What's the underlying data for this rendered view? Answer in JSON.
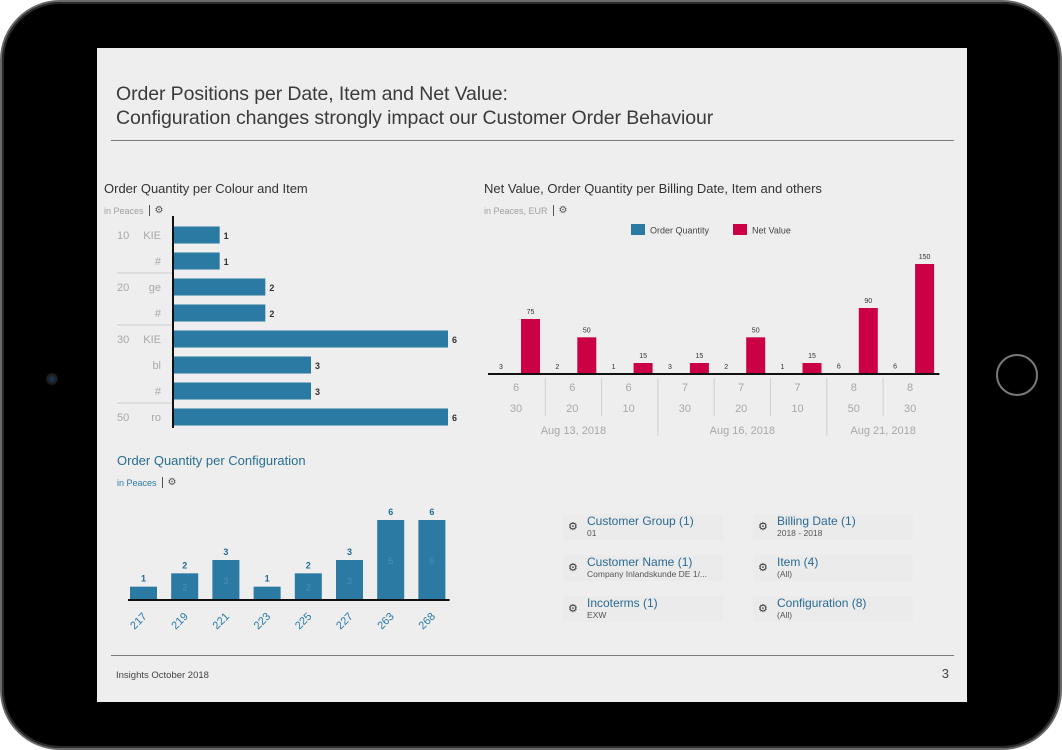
{
  "slide": {
    "title_line1": "Order Positions per Date, Item and Net Value:",
    "title_line2": "Configuration changes strongly impact our Customer Order Behaviour",
    "footer": "Insights October 2018",
    "page_number": "3"
  },
  "colors": {
    "order_quantity": "#2a7aa3",
    "net_value": "#cc0044",
    "accent_blue": "#286f91"
  },
  "chart_data": [
    {
      "id": "colour_item",
      "type": "bar",
      "orientation": "horizontal",
      "title": "Order Quantity per Colour and Item",
      "subtitle": "in Peaces",
      "rows": [
        {
          "group": "10",
          "item": "KIE",
          "value": 1
        },
        {
          "group": "",
          "item": "#",
          "value": 1
        },
        {
          "group": "20",
          "item": "ge",
          "value": 2
        },
        {
          "group": "",
          "item": "#",
          "value": 2
        },
        {
          "group": "30",
          "item": "KIE",
          "value": 6
        },
        {
          "group": "",
          "item": "bl",
          "value": 3
        },
        {
          "group": "",
          "item": "#",
          "value": 3
        },
        {
          "group": "50",
          "item": "ro",
          "value": 6
        }
      ],
      "xlim": [
        0,
        6
      ]
    },
    {
      "id": "billing_date",
      "type": "bar",
      "title": "Net Value, Order Quantity per Billing Date, Item and others",
      "subtitle": "in Peaces, EUR",
      "legend": [
        "Order Quantity",
        "Net Value"
      ],
      "legend_position": "top-center",
      "categories": [
        {
          "level1": "6",
          "level2": "30",
          "date": "Aug 13, 2018"
        },
        {
          "level1": "6",
          "level2": "20",
          "date": "Aug 13, 2018"
        },
        {
          "level1": "6",
          "level2": "10",
          "date": "Aug 13, 2018"
        },
        {
          "level1": "7",
          "level2": "30",
          "date": "Aug 16, 2018"
        },
        {
          "level1": "7",
          "level2": "20",
          "date": "Aug 16, 2018"
        },
        {
          "level1": "7",
          "level2": "10",
          "date": "Aug 16, 2018"
        },
        {
          "level1": "8",
          "level2": "50",
          "date": "Aug 21, 2018"
        },
        {
          "level1": "8",
          "level2": "30",
          "date": "Aug 21, 2018"
        }
      ],
      "dates": [
        "Aug 13, 2018",
        "Aug 16, 2018",
        "Aug 21, 2018"
      ],
      "series": [
        {
          "name": "Order Quantity",
          "values": [
            3,
            2,
            1,
            3,
            2,
            1,
            6,
            6
          ]
        },
        {
          "name": "Net Value",
          "values": [
            75,
            50,
            15,
            15,
            50,
            15,
            90,
            150
          ]
        }
      ],
      "ylim": [
        0,
        150
      ]
    },
    {
      "id": "configuration",
      "type": "bar",
      "title": "Order Quantity per Configuration",
      "subtitle": "in Peaces",
      "categories": [
        "217",
        "219",
        "221",
        "223",
        "225",
        "227",
        "263",
        "268"
      ],
      "values": [
        1,
        2,
        3,
        1,
        2,
        3,
        6,
        6
      ],
      "ylim": [
        0,
        6
      ]
    }
  ],
  "filters": [
    {
      "name": "Customer Group (1)",
      "value": "01",
      "icon": "filter-gear-icon"
    },
    {
      "name": "Billing Date (1)",
      "value": "2018 - 2018",
      "icon": "filter-gear-icon"
    },
    {
      "name": "Customer Name (1)",
      "value": "Company Inlandskunde DE 1/...",
      "icon": "filter-gear-icon"
    },
    {
      "name": "Item (4)",
      "value": "(All)",
      "icon": "filter-gear-icon"
    },
    {
      "name": "Incoterms (1)",
      "value": "EXW",
      "icon": "filter-gear-icon"
    },
    {
      "name": "Configuration (8)",
      "value": "(All)",
      "icon": "filter-gear-icon"
    }
  ],
  "icons": {
    "gear": "⚙"
  }
}
